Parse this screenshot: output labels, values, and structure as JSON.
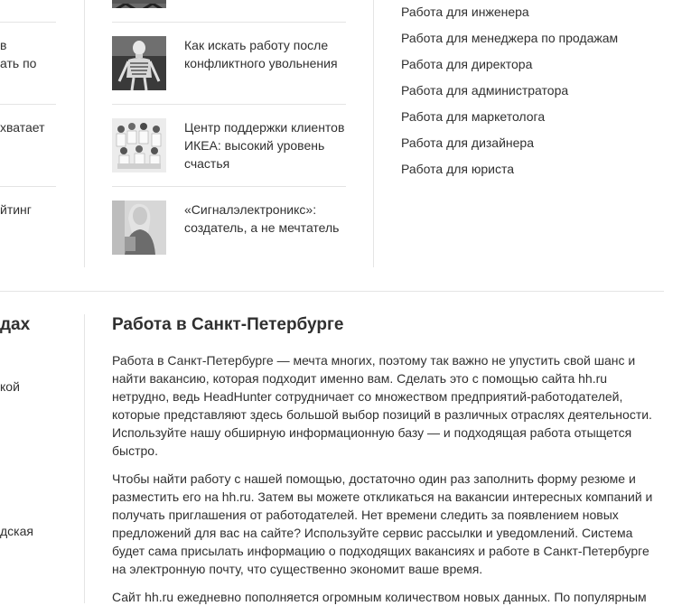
{
  "left_column": {
    "fragments": [
      {
        "text": "в"
      },
      {
        "text": "ать по"
      },
      {
        "text": "хватает"
      },
      {
        "text": "йтинг"
      }
    ],
    "heading": "дах",
    "lower_fragments": [
      {
        "text": "кой"
      },
      {
        "text": "дская"
      }
    ]
  },
  "articles": [
    {
      "title": "Как искать работу после конфликтного увольнения",
      "image": "skeleton-photo"
    },
    {
      "title": "Центр поддержки клиентов ИКЕА: высокий уровень счастья",
      "image": "team-photo"
    },
    {
      "title": "«Сигналэлектроникс»: создатель, а не мечтатель",
      "image": "woman-portrait-photo"
    }
  ],
  "job_links": [
    "Работа для инженера",
    "Работа для менеджера по продажам",
    "Работа для директора",
    "Работа для администратора",
    "Работа для маркетолога",
    "Работа для дизайнера",
    "Работа для юриста"
  ],
  "seo": {
    "title": "Работа в Санкт-Петербурге",
    "paragraphs": [
      "Работа в Санкт-Петербурге — мечта многих, поэтому так важно не упустить свой шанс и найти вакансию, которая подходит именно вам. Сделать это с помощью сайта hh.ru нетрудно, ведь HeadHunter сотрудничает со множеством предприятий-работодателей, которые представляют здесь большой выбор позиций в различных отраслях деятельности. Используйте нашу обширную информационную базу — и подходящая работа отыщется быстро.",
      "Чтобы найти работу с нашей помощью, достаточно один раз заполнить форму резюме и разместить его на hh.ru. Затем вы можете откликаться на вакансии интересных компаний и получать приглашения от работодателей. Нет времени следить за появлением новых предложений для вас на сайте? Используйте сервис рассылки и уведомлений. Система будет сама присылать информацию о подходящих вакансиях и работе в Санкт-Петербурге на электронную почту, что существенно экономит ваше время.",
      "Сайт hh.ru ежедневно пополняется огромным количеством новых данных. По популярным"
    ]
  }
}
